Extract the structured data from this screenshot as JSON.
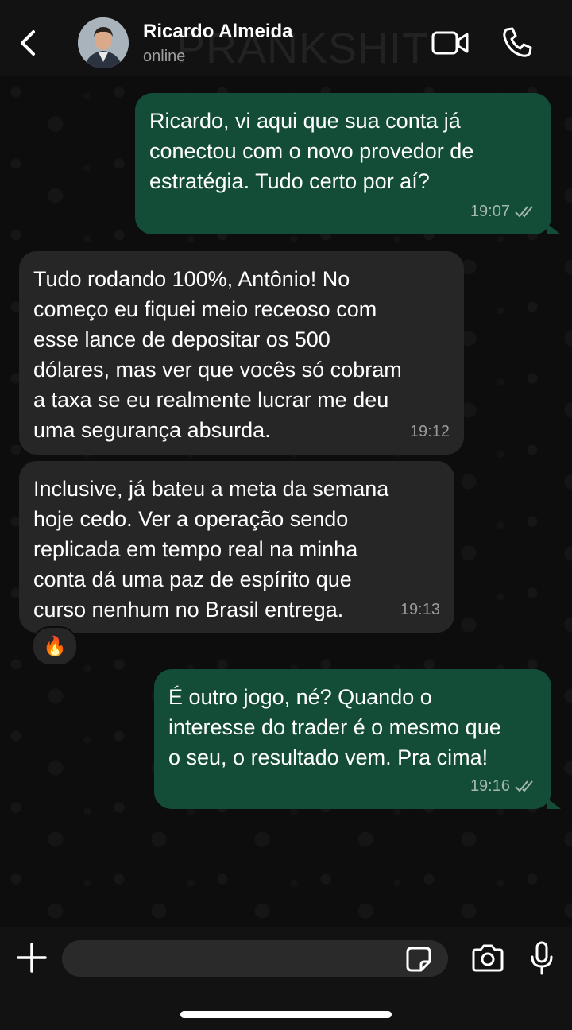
{
  "header": {
    "contact_name": "Ricardo Almeida",
    "status": "online"
  },
  "watermark": "PRANKSHIT",
  "messages": [
    {
      "direction": "out",
      "text": "Ricardo, vi aqui que sua conta já\nconectou com o novo provedor de\nestratégia. Tudo certo por aí?",
      "time": "19:07",
      "status": "read"
    },
    {
      "direction": "in",
      "text": "Tudo rodando 100%, Antônio! No\ncomeço eu fiquei meio receoso com\nesse lance de depositar os 500\ndólares, mas ver que vocês só cobram\na taxa se eu realmente lucrar me deu\numa segurança absurda.",
      "time": "19:12"
    },
    {
      "direction": "in",
      "text": "Inclusive, já bateu a meta da semana\nhoje cedo. Ver a operação sendo\nreplicada em tempo real na minha\nconta dá uma paz de espírito que\ncurso nenhum no Brasil entrega.",
      "time": "19:13",
      "reaction": "🔥"
    },
    {
      "direction": "out",
      "text": "É outro jogo, né? Quando o\ninteresse do trader é o mesmo que\no seu, o resultado vem. Pra cima!",
      "time": "19:16",
      "status": "read"
    }
  ],
  "icons": {
    "back": "chevron-left-icon",
    "video": "video-camera-icon",
    "call": "phone-icon",
    "plus": "plus-icon",
    "sticker": "sticker-icon",
    "camera": "camera-icon",
    "mic": "microphone-icon",
    "read_receipt": "double-check-icon",
    "reaction": "fire-emoji"
  },
  "colors": {
    "outgoing_bubble": "#134d37",
    "incoming_bubble": "#262626",
    "header_bg": "#121212"
  },
  "composer": {
    "value": "",
    "placeholder": ""
  }
}
